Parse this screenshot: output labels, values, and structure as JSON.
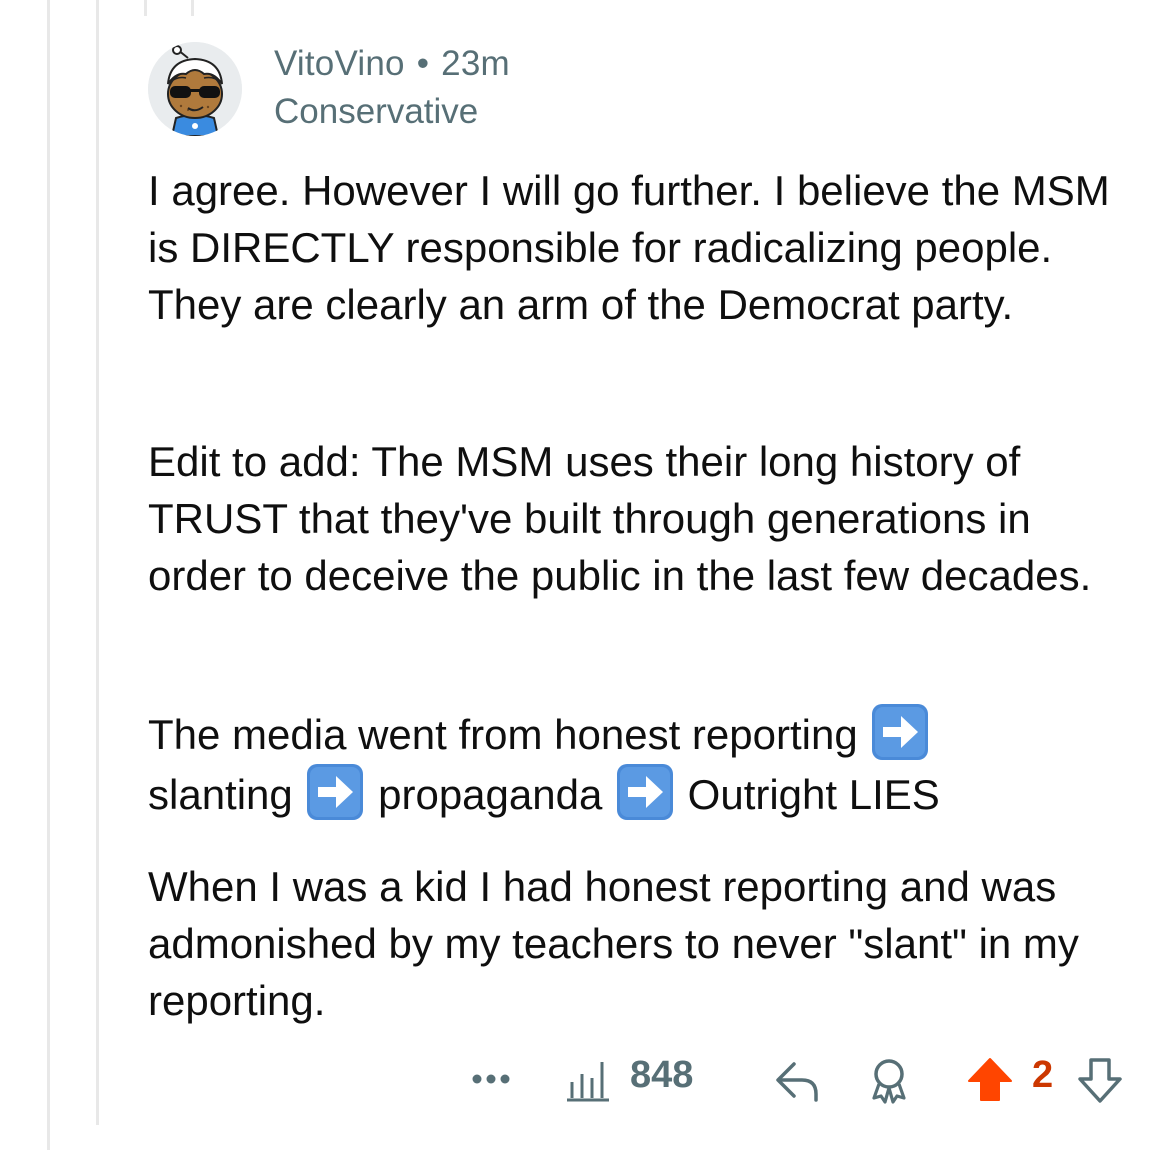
{
  "comment": {
    "username": "VitoVino",
    "separator": "•",
    "time_ago": "23m",
    "flair": "Conservative",
    "paragraph_1": "I agree. However I will go further.  I believe the MSM is DIRECTLY responsible for radicalizing people.  They are clearly an arm of the Democrat party.",
    "paragraph_2": "Edit to add:  The MSM uses their long history of TRUST that they've built through generations in order to deceive the public in the last few decades.",
    "paragraph_3": {
      "segment_1": "The media went from honest reporting",
      "segment_2": "slanting",
      "segment_3": "propaganda",
      "segment_4": "Outright LIES"
    },
    "paragraph_4": "When I was a kid  I had honest reporting and was admonished by my teachers to never \"slant\" in my reporting."
  },
  "actions": {
    "more_icon": "more-dots-icon",
    "views_icon": "views-chart-icon",
    "views_count": "848",
    "reply_icon": "reply-arrow-icon",
    "award_icon": "award-icon",
    "upvote_icon": "upvote-arrow-icon",
    "vote_count": "2",
    "downvote_icon": "downvote-arrow-icon"
  },
  "colors": {
    "meta_text": "#576f76",
    "upvote_active": "#ff4500",
    "vote_count": "#cc3700",
    "arrow_emoji_blue": "#4a8ad8",
    "thread_line": "#e8e8e8"
  }
}
